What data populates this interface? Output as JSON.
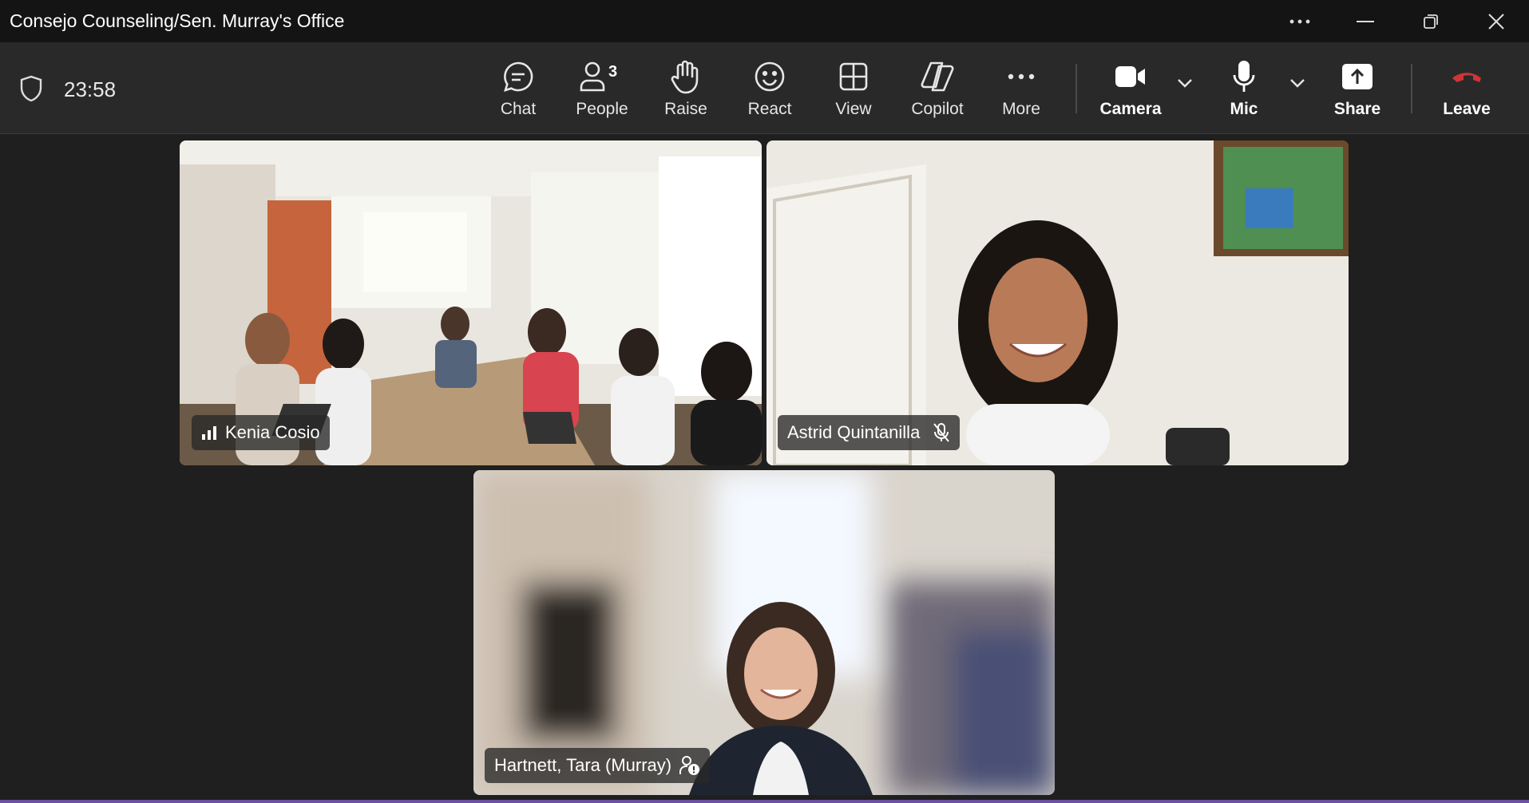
{
  "window": {
    "title": "Consejo Counseling/Sen. Murray's Office",
    "controls": [
      "more-options",
      "minimize",
      "restore",
      "close"
    ]
  },
  "meeting": {
    "elapsed": "23:58"
  },
  "toolbar": {
    "chat_label": "Chat",
    "people_label": "People",
    "people_count": "3",
    "raise_label": "Raise",
    "react_label": "React",
    "view_label": "View",
    "copilot_label": "Copilot",
    "more_label": "More",
    "camera_label": "Camera",
    "mic_label": "Mic",
    "share_label": "Share",
    "leave_label": "Leave"
  },
  "participants": [
    {
      "name": "Kenia Cosio",
      "indicator": "signal-strength-icon"
    },
    {
      "name": "Astrid Quintanilla",
      "indicator": "mic-muted-icon"
    },
    {
      "name": "Hartnett, Tara (Murray)",
      "indicator": "external-user-icon"
    }
  ],
  "colors": {
    "titlebar": "#141414",
    "toolbar": "#292929",
    "stage": "#1f1f1f",
    "leave_red": "#d13438",
    "accent_bar": "#6b4fa0"
  }
}
